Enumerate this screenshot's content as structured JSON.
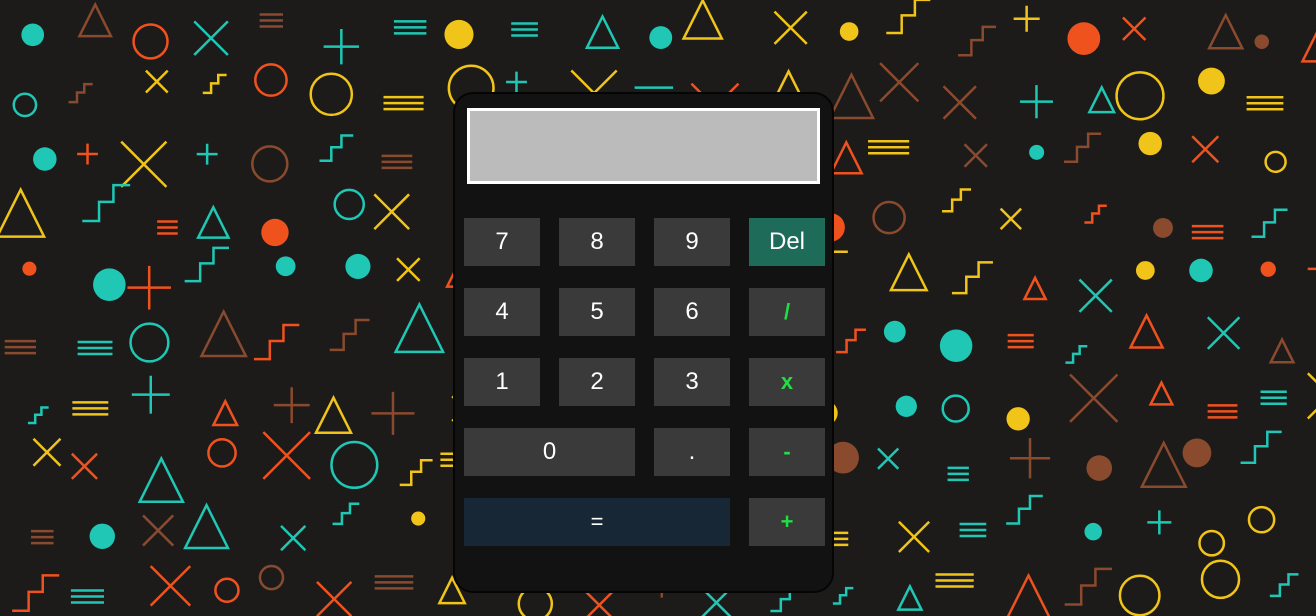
{
  "display": {
    "value": ""
  },
  "keys": {
    "seven": "7",
    "eight": "8",
    "nine": "9",
    "del": "Del",
    "four": "4",
    "five": "5",
    "six": "6",
    "divide": "/",
    "one": "1",
    "two": "2",
    "three": "3",
    "multiply": "x",
    "zero": "0",
    "decimal": ".",
    "minus": "-",
    "equals": "=",
    "plus": "+"
  },
  "colors": {
    "operator_text": "#22dd44",
    "del_bg": "#1e6b5a",
    "equals_bg": "#172736",
    "key_bg": "#3a3a3a",
    "display_bg": "#bbbbbb"
  }
}
